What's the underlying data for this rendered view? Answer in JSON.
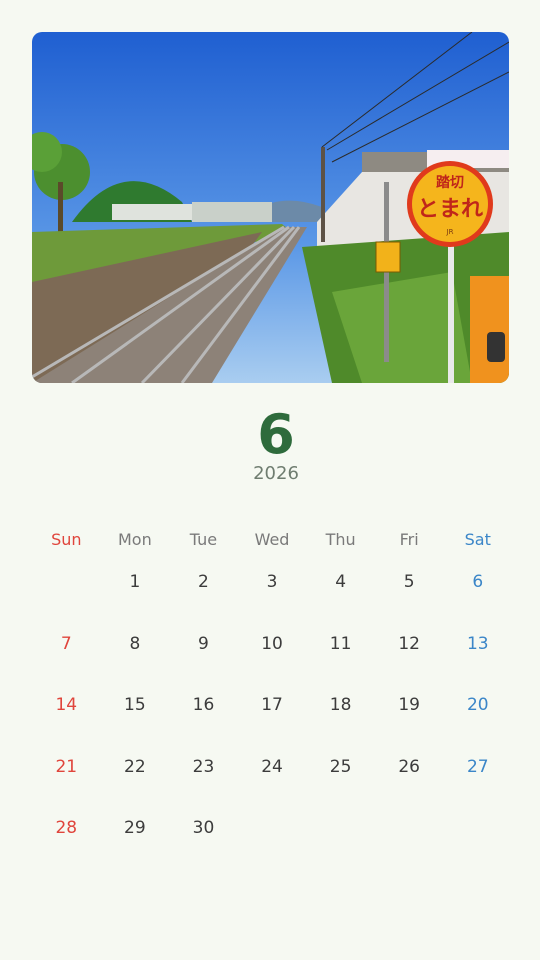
{
  "photo": {
    "description_icon": "railway-crossing-photo",
    "sign_top_text": "踏切",
    "sign_main_text": "とまれ",
    "sign_small_text": "JR"
  },
  "header": {
    "month": "6",
    "year": "2026"
  },
  "calendar": {
    "weekdays": [
      "Sun",
      "Mon",
      "Tue",
      "Wed",
      "Thu",
      "Fri",
      "Sat"
    ],
    "weeks": [
      [
        "",
        "1",
        "2",
        "3",
        "4",
        "5",
        "6"
      ],
      [
        "7",
        "8",
        "9",
        "10",
        "11",
        "12",
        "13"
      ],
      [
        "14",
        "15",
        "16",
        "17",
        "18",
        "19",
        "20"
      ],
      [
        "21",
        "22",
        "23",
        "24",
        "25",
        "26",
        "27"
      ],
      [
        "28",
        "29",
        "30",
        "",
        "",
        "",
        ""
      ]
    ]
  },
  "colors": {
    "month": "#2e6b3c",
    "sunday": "#e0453c",
    "saturday": "#3b86c8",
    "background": "#f6f9f2"
  }
}
